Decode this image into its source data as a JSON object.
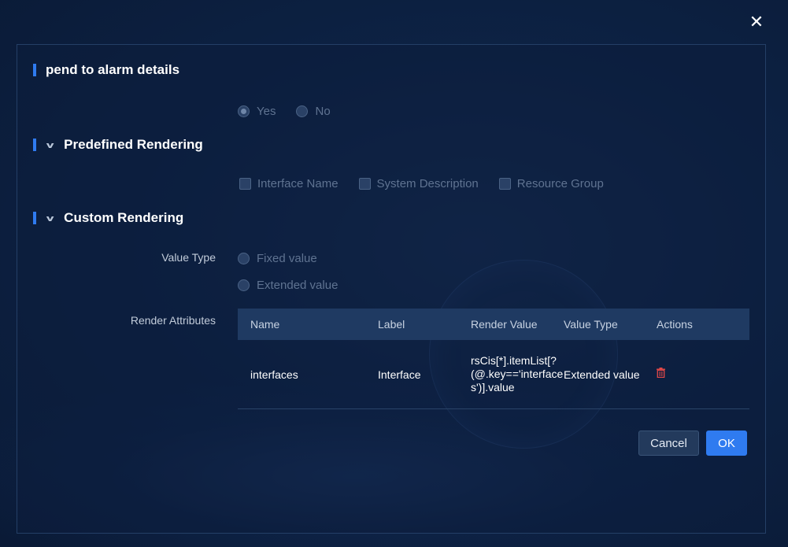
{
  "close_icon": "close-icon",
  "header": {
    "title": "pend to alarm details"
  },
  "append_option": {
    "options": [
      {
        "label": "Yes",
        "checked": true
      },
      {
        "label": "No",
        "checked": false
      }
    ]
  },
  "predefined": {
    "title": "Predefined Rendering",
    "options": [
      {
        "label": "Interface Name"
      },
      {
        "label": "System Description"
      },
      {
        "label": "Resource Group"
      }
    ]
  },
  "custom": {
    "title": "Custom Rendering",
    "value_type_label": "Value Type",
    "value_type_options": [
      {
        "label": "Fixed value"
      },
      {
        "label": "Extended value"
      }
    ],
    "render_attributes_label": "Render Attributes",
    "table": {
      "headers": [
        "Name",
        "Label",
        "Render Value",
        "Value Type",
        "Actions"
      ],
      "rows": [
        {
          "name": "interfaces",
          "label": "Interface",
          "render_value": "rsCis[*].itemList[?(@.key=='interfaces')].value",
          "value_type": "Extended value",
          "action_icon": "trash-icon"
        }
      ]
    }
  },
  "footer": {
    "cancel_label": "Cancel",
    "ok_label": "OK"
  },
  "colors": {
    "accent": "#2f7bf0",
    "danger": "#e04848",
    "background": "#0d2244"
  }
}
